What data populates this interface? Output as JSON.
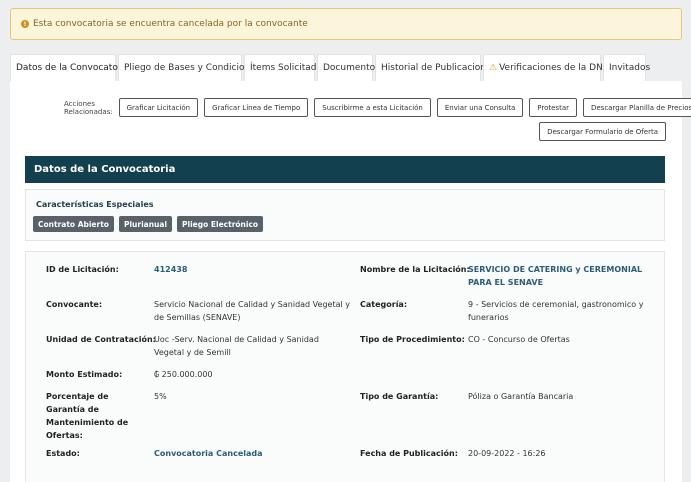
{
  "alert": {
    "text": "Esta convocatoria se encuentra cancelada por la convocante",
    "icon": "exclamation-circle-icon"
  },
  "tabs": [
    {
      "label": "Datos de la Convocatoria",
      "active": true
    },
    {
      "label": "Pliego de Bases y Condiciones"
    },
    {
      "label": "Ítems Solicitados"
    },
    {
      "label": "Documentos"
    },
    {
      "label": "Historial de Publicaciones"
    },
    {
      "label": "Verificaciones de la DNCP",
      "icon": "warning-icon"
    },
    {
      "label": "Invitados"
    }
  ],
  "actions": {
    "label": "Acciones Relacionadas:",
    "buttons": [
      "Graficar Licitación",
      "Graficar Línea de Tiempo",
      "Suscribirme a esta Licitación",
      "Enviar una Consulta",
      "Protestar",
      "Descargar Planilla de Precios",
      "Descargar Formulario de Oferta"
    ]
  },
  "section": {
    "title": "Datos de la Convocatoria"
  },
  "special": {
    "title": "Características Especiales",
    "badges": [
      "Contrato Abierto",
      "Plurianual",
      "Pliego Electrónico"
    ]
  },
  "details": {
    "id_label": "ID de Licitación:",
    "id_value": "412438",
    "nombre_label": "Nombre de la Licitación:",
    "nombre_value": "SERVICIO DE CATERING y CEREMONIAL PARA EL SENAVE",
    "convocante_label": "Convocante:",
    "convocante_value": "Servicio Nacional de Calidad y Sanidad Vegetal y de Semillas (SENAVE)",
    "categoria_label": "Categoría:",
    "categoria_value": "9 - Servicios de ceremonial, gastronomico y funerarios",
    "unidad_label": "Unidad de Contratación:",
    "unidad_value": "Uoc -Serv. Nacional de Calidad y Sanidad Vegetal y de Semill",
    "tipo_proc_label": "Tipo de Procedimiento:",
    "tipo_proc_value": "CO - Concurso de Ofertas",
    "monto_label": "Monto Estimado:",
    "monto_value": "₲ 250.000.000",
    "porcentaje_label": "Porcentaje de Garantía de Mantenimiento de Ofertas:",
    "porcentaje_value": "5%",
    "tipo_garantia_label": "Tipo de Garantía:",
    "tipo_garantia_value": "Póliza o Garantía Bancaria",
    "estado_label": "Estado:",
    "estado_value": "Convocatoria Cancelada",
    "fecha_label": "Fecha de Publicación:",
    "fecha_value": "20-09-2022 - 16:26"
  }
}
